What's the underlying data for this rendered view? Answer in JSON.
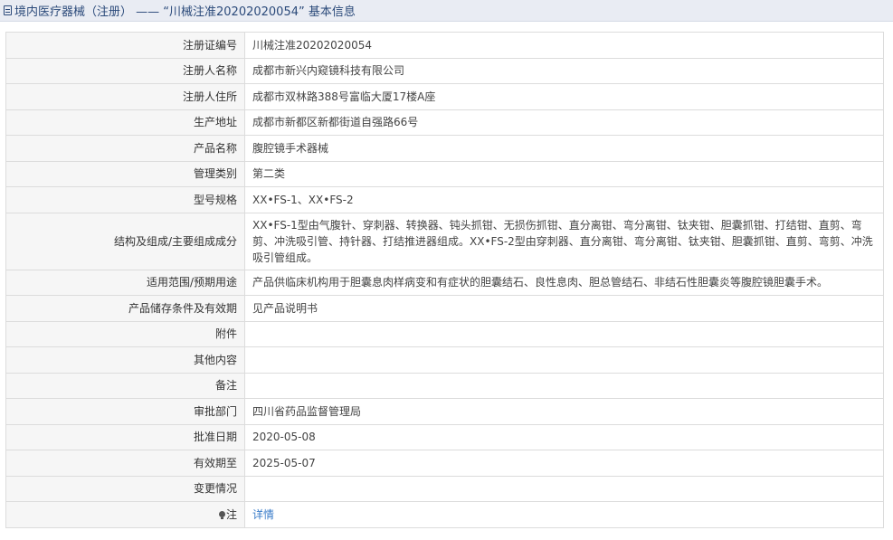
{
  "header": {
    "icon": "document-icon",
    "title": "境内医疗器械（注册） —— “川械注准20202020054” 基本信息"
  },
  "rows": [
    {
      "label": "注册证编号",
      "value": "川械注准20202020054"
    },
    {
      "label": "注册人名称",
      "value": "成都市新兴内窥镜科技有限公司"
    },
    {
      "label": "注册人住所",
      "value": "成都市双林路388号富临大厦17楼A座"
    },
    {
      "label": "生产地址",
      "value": "成都市新都区新都街道自强路66号"
    },
    {
      "label": "产品名称",
      "value": "腹腔镜手术器械"
    },
    {
      "label": "管理类别",
      "value": "第二类"
    },
    {
      "label": "型号规格",
      "value": "XX•FS-1、XX•FS-2"
    },
    {
      "label": "结构及组成/主要组成成分",
      "value": "XX•FS-1型由气腹针、穿刺器、转换器、钝头抓钳、无损伤抓钳、直分离钳、弯分离钳、钛夹钳、胆囊抓钳、打结钳、直剪、弯剪、冲洗吸引管、持针器、打结推进器组成。XX•FS-2型由穿刺器、直分离钳、弯分离钳、钛夹钳、胆囊抓钳、直剪、弯剪、冲洗吸引管组成。"
    },
    {
      "label": "适用范围/预期用途",
      "value": "产品供临床机构用于胆囊息肉样病变和有症状的胆囊结石、良性息肉、胆总管结石、非结石性胆囊炎等腹腔镜胆囊手术。"
    },
    {
      "label": "产品储存条件及有效期",
      "value": "见产品说明书"
    },
    {
      "label": "附件",
      "value": ""
    },
    {
      "label": "其他内容",
      "value": ""
    },
    {
      "label": "备注",
      "value": ""
    },
    {
      "label": "审批部门",
      "value": "四川省药品监督管理局"
    },
    {
      "label": "批准日期",
      "value": "2020-05-08"
    },
    {
      "label": "有效期至",
      "value": "2025-05-07"
    },
    {
      "label": "变更情况",
      "value": ""
    }
  ],
  "note_row": {
    "icon": "lightbulb-icon",
    "label": "注",
    "link": "详情"
  }
}
